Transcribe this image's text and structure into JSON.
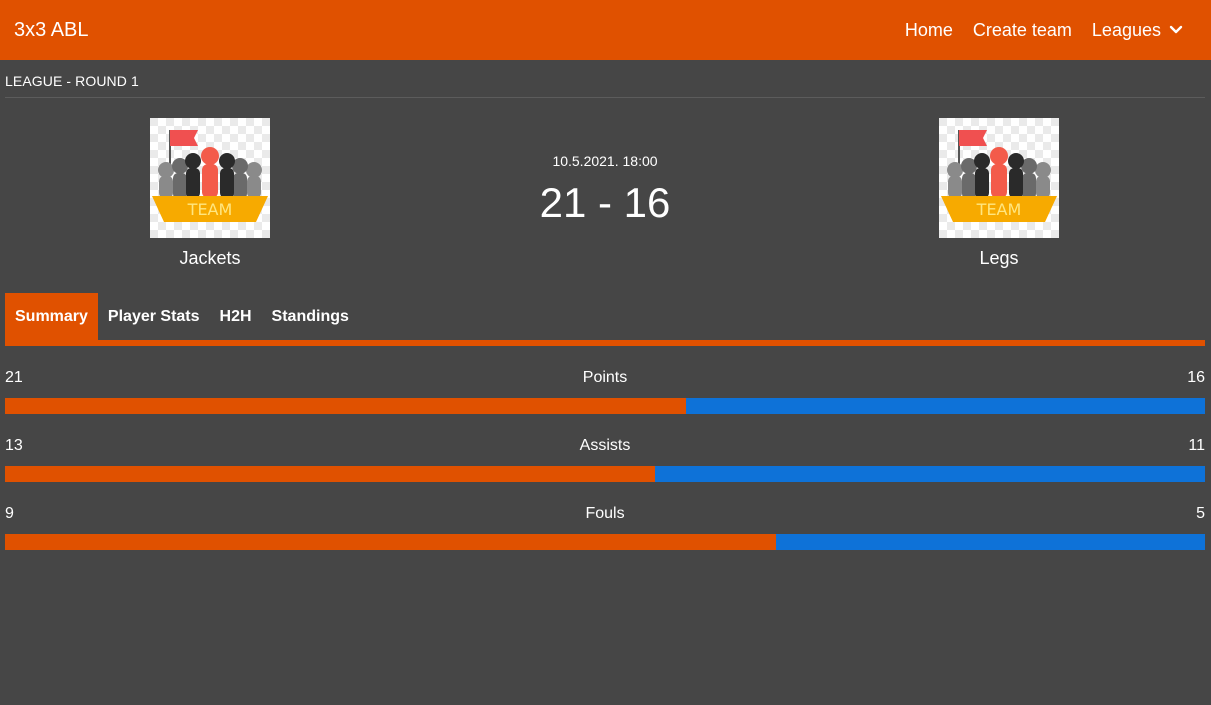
{
  "navbar": {
    "brand": "3x3 ABL",
    "items": [
      "Home",
      "Create team",
      "Leagues"
    ]
  },
  "breadcrumb": "LEAGUE - ROUND 1",
  "match": {
    "datetime": "10.5.2021. 18:00",
    "score": "21 - 16",
    "home": {
      "name": "Jackets",
      "logo_text": "TEAM"
    },
    "away": {
      "name": "Legs",
      "logo_text": "TEAM"
    }
  },
  "tabs": [
    "Summary",
    "Player Stats",
    "H2H",
    "Standings"
  ],
  "stats": [
    {
      "label": "Points",
      "home": "21",
      "away": "16"
    },
    {
      "label": "Assists",
      "home": "13",
      "away": "11"
    },
    {
      "label": "Fouls",
      "home": "9",
      "away": "5"
    }
  ],
  "colors": {
    "accent": "#e05100",
    "away": "#0e72d8",
    "background": "#464646"
  }
}
